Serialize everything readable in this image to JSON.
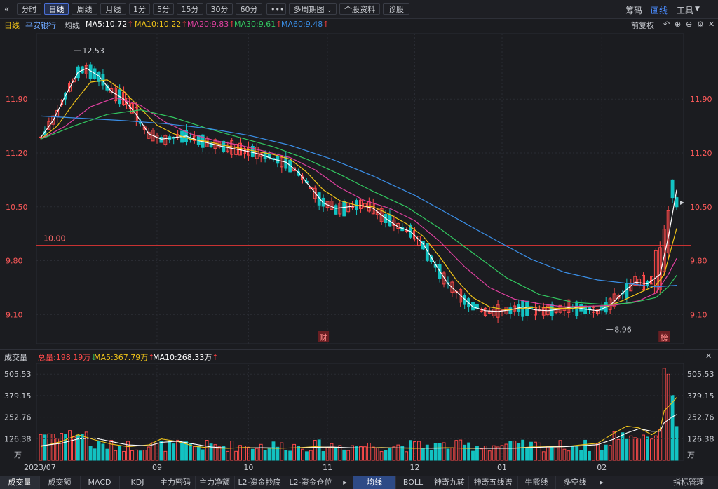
{
  "toolbar": {
    "back_icon": "double-left-icon",
    "tabs": [
      "分时",
      "日线",
      "周线",
      "月线",
      "1分",
      "5分",
      "15分",
      "30分",
      "60分",
      "•••",
      "多周期图",
      "个股资料",
      "诊股"
    ],
    "active": "日线",
    "right": [
      "筹码",
      "画线",
      "工具"
    ]
  },
  "ma_bar": {
    "period": "日线",
    "stock": "平安银行",
    "type": "均线",
    "ma5": "MA5:10.72",
    "ma10": "MA10:10.22",
    "ma20": "MA20:9.83",
    "ma30": "MA30:9.61",
    "ma60": "MA60:9.48",
    "right_label": "前复权"
  },
  "volume_bar": {
    "title": "成交量",
    "total": "总量:198.19万",
    "ma5": "MA5:367.79万",
    "ma10": "MA10:268.33万"
  },
  "colors": {
    "up": "#ff4a4a",
    "down": "#13c2c2",
    "ma5": "#ffffff",
    "ma10": "#f0c419",
    "ma20": "#e040a0",
    "ma30": "#32c860",
    "ma60": "#3a8ee6",
    "hline": "#c83232"
  },
  "chart_data": {
    "type": "candlestick",
    "price_axis_ticks": [
      "11.90",
      "11.20",
      "10.50",
      "9.80",
      "9.10"
    ],
    "price_range": [
      8.72,
      12.75
    ],
    "price_line_label": "10.00",
    "max_label": "12.53",
    "min_label": "8.96",
    "x_tick_labels": [
      "2023/07",
      "09",
      "10",
      "11",
      "12",
      "01",
      "02"
    ],
    "event_markers": [
      "财",
      "榜"
    ],
    "unit": "万",
    "volume_axis_ticks": [
      "505.53",
      "379.15",
      "252.76",
      "126.38"
    ],
    "volume_range": [
      0,
      560
    ],
    "x_last_index": 153,
    "x_tick_indices": [
      0,
      28,
      50,
      69,
      90,
      111,
      135
    ],
    "event_marker_indices": [
      68,
      150
    ],
    "max_index": 8,
    "min_index": 136,
    "ma_lines": [
      {
        "name": "MA5",
        "color_key": "ma5",
        "points": [
          [
            0,
            11.4
          ],
          [
            3,
            11.62
          ],
          [
            6,
            11.95
          ],
          [
            9,
            12.25
          ],
          [
            11,
            12.3
          ],
          [
            14,
            12.2
          ],
          [
            17,
            12.0
          ],
          [
            20,
            11.9
          ],
          [
            23,
            11.7
          ],
          [
            26,
            11.45
          ],
          [
            29,
            11.38
          ],
          [
            32,
            11.4
          ],
          [
            35,
            11.42
          ],
          [
            38,
            11.36
          ],
          [
            41,
            11.32
          ],
          [
            44,
            11.28
          ],
          [
            47,
            11.25
          ],
          [
            50,
            11.22
          ],
          [
            53,
            11.18
          ],
          [
            56,
            11.12
          ],
          [
            59,
            11.08
          ],
          [
            62,
            10.95
          ],
          [
            65,
            10.75
          ],
          [
            68,
            10.55
          ],
          [
            71,
            10.48
          ],
          [
            74,
            10.5
          ],
          [
            77,
            10.52
          ],
          [
            80,
            10.48
          ],
          [
            83,
            10.35
          ],
          [
            86,
            10.24
          ],
          [
            89,
            10.18
          ],
          [
            92,
            10.02
          ],
          [
            95,
            9.75
          ],
          [
            98,
            9.5
          ],
          [
            101,
            9.35
          ],
          [
            104,
            9.2
          ],
          [
            107,
            9.15
          ],
          [
            110,
            9.14
          ],
          [
            113,
            9.16
          ],
          [
            116,
            9.2
          ],
          [
            119,
            9.16
          ],
          [
            122,
            9.15
          ],
          [
            125,
            9.17
          ],
          [
            128,
            9.2
          ],
          [
            131,
            9.17
          ],
          [
            134,
            9.15
          ],
          [
            137,
            9.22
          ],
          [
            140,
            9.38
          ],
          [
            143,
            9.52
          ],
          [
            146,
            9.5
          ],
          [
            149,
            9.62
          ],
          [
            151,
            10.1
          ],
          [
            153,
            10.72
          ]
        ]
      },
      {
        "name": "MA10",
        "color_key": "ma10",
        "points": [
          [
            0,
            11.38
          ],
          [
            4,
            11.55
          ],
          [
            8,
            11.85
          ],
          [
            12,
            12.12
          ],
          [
            16,
            12.15
          ],
          [
            20,
            12.0
          ],
          [
            24,
            11.78
          ],
          [
            28,
            11.56
          ],
          [
            32,
            11.45
          ],
          [
            36,
            11.38
          ],
          [
            40,
            11.35
          ],
          [
            44,
            11.3
          ],
          [
            48,
            11.26
          ],
          [
            52,
            11.22
          ],
          [
            56,
            11.18
          ],
          [
            60,
            11.12
          ],
          [
            64,
            10.95
          ],
          [
            68,
            10.72
          ],
          [
            72,
            10.58
          ],
          [
            76,
            10.52
          ],
          [
            80,
            10.5
          ],
          [
            84,
            10.4
          ],
          [
            88,
            10.28
          ],
          [
            92,
            10.12
          ],
          [
            96,
            9.85
          ],
          [
            100,
            9.55
          ],
          [
            104,
            9.32
          ],
          [
            108,
            9.2
          ],
          [
            112,
            9.16
          ],
          [
            116,
            9.18
          ],
          [
            120,
            9.2
          ],
          [
            124,
            9.18
          ],
          [
            128,
            9.18
          ],
          [
            132,
            9.2
          ],
          [
            136,
            9.2
          ],
          [
            140,
            9.28
          ],
          [
            144,
            9.38
          ],
          [
            148,
            9.48
          ],
          [
            150,
            9.62
          ],
          [
            152,
            10.02
          ],
          [
            153,
            10.22
          ]
        ]
      },
      {
        "name": "MA20",
        "color_key": "ma20",
        "points": [
          [
            0,
            11.38
          ],
          [
            6,
            11.55
          ],
          [
            12,
            11.8
          ],
          [
            18,
            11.92
          ],
          [
            24,
            11.82
          ],
          [
            30,
            11.6
          ],
          [
            36,
            11.45
          ],
          [
            42,
            11.36
          ],
          [
            48,
            11.3
          ],
          [
            54,
            11.22
          ],
          [
            60,
            11.14
          ],
          [
            66,
            10.98
          ],
          [
            72,
            10.75
          ],
          [
            78,
            10.58
          ],
          [
            84,
            10.48
          ],
          [
            90,
            10.32
          ],
          [
            96,
            10.05
          ],
          [
            102,
            9.72
          ],
          [
            108,
            9.45
          ],
          [
            114,
            9.3
          ],
          [
            120,
            9.24
          ],
          [
            126,
            9.2
          ],
          [
            132,
            9.21
          ],
          [
            138,
            9.22
          ],
          [
            144,
            9.28
          ],
          [
            148,
            9.38
          ],
          [
            151,
            9.62
          ],
          [
            153,
            9.83
          ]
        ]
      },
      {
        "name": "MA30",
        "color_key": "ma30",
        "points": [
          [
            0,
            11.38
          ],
          [
            8,
            11.55
          ],
          [
            16,
            11.7
          ],
          [
            24,
            11.76
          ],
          [
            32,
            11.66
          ],
          [
            40,
            11.52
          ],
          [
            48,
            11.4
          ],
          [
            56,
            11.28
          ],
          [
            64,
            11.12
          ],
          [
            72,
            10.92
          ],
          [
            80,
            10.7
          ],
          [
            88,
            10.5
          ],
          [
            96,
            10.22
          ],
          [
            104,
            9.9
          ],
          [
            112,
            9.58
          ],
          [
            120,
            9.36
          ],
          [
            128,
            9.26
          ],
          [
            136,
            9.23
          ],
          [
            142,
            9.25
          ],
          [
            148,
            9.32
          ],
          [
            151,
            9.46
          ],
          [
            153,
            9.61
          ]
        ]
      },
      {
        "name": "MA60",
        "color_key": "ma60",
        "points": [
          [
            0,
            11.68
          ],
          [
            10,
            11.65
          ],
          [
            20,
            11.62
          ],
          [
            30,
            11.58
          ],
          [
            40,
            11.52
          ],
          [
            50,
            11.43
          ],
          [
            60,
            11.3
          ],
          [
            70,
            11.12
          ],
          [
            80,
            10.9
          ],
          [
            90,
            10.65
          ],
          [
            100,
            10.35
          ],
          [
            110,
            10.05
          ],
          [
            118,
            9.82
          ],
          [
            126,
            9.65
          ],
          [
            134,
            9.55
          ],
          [
            142,
            9.5
          ],
          [
            148,
            9.46
          ],
          [
            153,
            9.48
          ]
        ]
      }
    ],
    "vol_ma_lines": [
      {
        "name": "MA5",
        "color_key": "ma10",
        "points": [
          [
            0,
            80
          ],
          [
            5,
            110
          ],
          [
            9,
            150
          ],
          [
            13,
            120
          ],
          [
            17,
            95
          ],
          [
            21,
            80
          ],
          [
            26,
            90
          ],
          [
            29,
            125
          ],
          [
            33,
            110
          ],
          [
            37,
            82
          ],
          [
            41,
            72
          ],
          [
            45,
            70
          ],
          [
            49,
            75
          ],
          [
            53,
            72
          ],
          [
            57,
            70
          ],
          [
            62,
            74
          ],
          [
            66,
            80
          ],
          [
            70,
            75
          ],
          [
            74,
            72
          ],
          [
            78,
            72
          ],
          [
            82,
            75
          ],
          [
            86,
            72
          ],
          [
            90,
            70
          ],
          [
            94,
            72
          ],
          [
            98,
            74
          ],
          [
            102,
            70
          ],
          [
            106,
            70
          ],
          [
            110,
            70
          ],
          [
            114,
            72
          ],
          [
            118,
            78
          ],
          [
            122,
            80
          ],
          [
            126,
            80
          ],
          [
            130,
            90
          ],
          [
            134,
            100
          ],
          [
            138,
            160
          ],
          [
            141,
            200
          ],
          [
            144,
            190
          ],
          [
            147,
            150
          ],
          [
            149,
            180
          ],
          [
            150,
            290
          ],
          [
            152,
            340
          ],
          [
            153,
            368
          ]
        ]
      },
      {
        "name": "MA10",
        "color_key": "ma5",
        "points": [
          [
            0,
            85
          ],
          [
            5,
            100
          ],
          [
            9,
            125
          ],
          [
            13,
            130
          ],
          [
            17,
            110
          ],
          [
            21,
            90
          ],
          [
            26,
            85
          ],
          [
            29,
            105
          ],
          [
            33,
            112
          ],
          [
            37,
            95
          ],
          [
            41,
            78
          ],
          [
            45,
            72
          ],
          [
            49,
            72
          ],
          [
            53,
            74
          ],
          [
            57,
            72
          ],
          [
            62,
            72
          ],
          [
            66,
            76
          ],
          [
            70,
            78
          ],
          [
            74,
            74
          ],
          [
            78,
            72
          ],
          [
            82,
            73
          ],
          [
            86,
            73
          ],
          [
            90,
            72
          ],
          [
            94,
            71
          ],
          [
            98,
            72
          ],
          [
            102,
            72
          ],
          [
            106,
            70
          ],
          [
            110,
            70
          ],
          [
            114,
            71
          ],
          [
            118,
            75
          ],
          [
            122,
            78
          ],
          [
            126,
            80
          ],
          [
            130,
            85
          ],
          [
            134,
            92
          ],
          [
            138,
            125
          ],
          [
            141,
            160
          ],
          [
            144,
            185
          ],
          [
            147,
            170
          ],
          [
            149,
            170
          ],
          [
            150,
            220
          ],
          [
            152,
            255
          ],
          [
            153,
            268
          ]
        ]
      }
    ]
  }
}
